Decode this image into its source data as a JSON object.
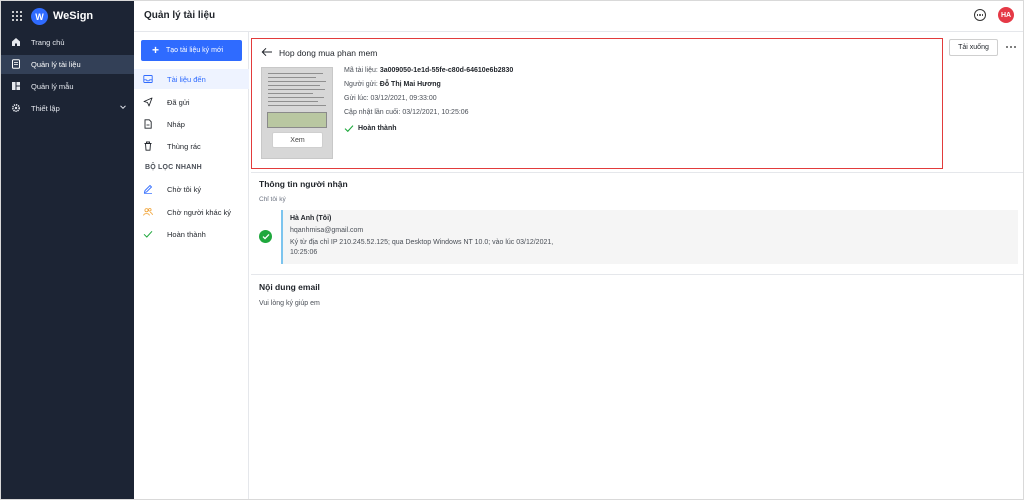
{
  "app": {
    "brand_name": "WeSign",
    "logo_letter": "W",
    "page_title": "Quản lý tài liệu",
    "avatar_initials": "HA"
  },
  "sidebar": {
    "items": [
      {
        "label": "Trang chủ",
        "icon": "home-icon"
      },
      {
        "label": "Quản lý tài liệu",
        "icon": "document-icon",
        "active": true
      },
      {
        "label": "Quản lý mẫu",
        "icon": "template-icon"
      },
      {
        "label": "Thiết lập",
        "icon": "settings-icon",
        "has_chevron": true
      }
    ]
  },
  "subnav": {
    "create_button": "Tạo tài liệu ký mới",
    "items": [
      {
        "label": "Tài liệu đến",
        "icon": "inbox-icon",
        "active": true
      },
      {
        "label": "Đã gửi",
        "icon": "send-icon"
      },
      {
        "label": "Nháp",
        "icon": "draft-icon"
      },
      {
        "label": "Thùng rác",
        "icon": "trash-icon"
      }
    ],
    "filter_title": "BỘ LỌC NHANH",
    "filters": [
      {
        "label": "Chờ tôi ký",
        "icon": "pen-icon"
      },
      {
        "label": "Chờ người khác ký",
        "icon": "users-icon"
      },
      {
        "label": "Hoàn thành",
        "icon": "check-icon"
      }
    ]
  },
  "document": {
    "title": "Hop dong mua phan mem",
    "view_button": "Xem",
    "id_label": "Mã tài liệu:",
    "id_value": "3a009050-1e1d-55fe-c80d-64610e6b2830",
    "sender_label": "Người gửi:",
    "sender_value": "Đỗ Thị Mai Hương",
    "sent_label": "Gửi lúc:",
    "sent_value": "03/12/2021, 09:33:00",
    "updated_label": "Cập nhật lần cuối:",
    "updated_value": "03/12/2021, 10:25:06",
    "status": "Hoàn thành",
    "download_button": "Tải xuống"
  },
  "recipients": {
    "section_title": "Thông tin người nhận",
    "group_label": "Chỉ tôi ký",
    "name": "Hà Anh (Tôi)",
    "email": "hqanhmisa@gmail.com",
    "signed_info_line1": "Ký từ địa chỉ IP 210.245.52.125; qua Desktop Windows NT 10.0; vào lúc 03/12/2021,",
    "signed_info_line2": "10:25:06"
  },
  "email": {
    "section_title": "Nội dung email",
    "body": "Vui lòng ký giúp em"
  },
  "colors": {
    "sidebar_bg": "#1c2434",
    "primary": "#2f6bff",
    "highlight_border": "#e23b3b",
    "success": "#1fa83d",
    "avatar": "#e53946"
  }
}
